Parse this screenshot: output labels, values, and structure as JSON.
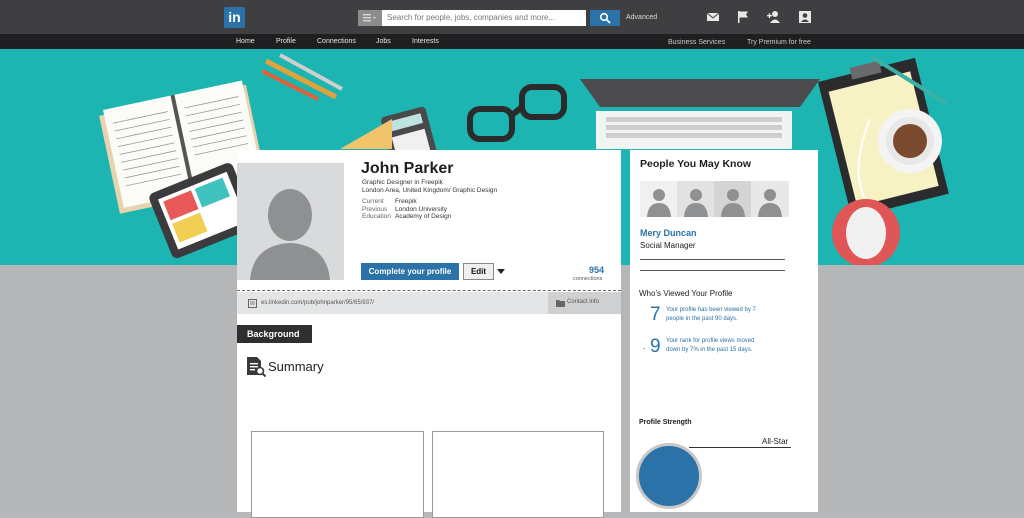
{
  "header": {
    "logo_text": "in",
    "search_placeholder": "Search for people, jobs, companies and more...",
    "advanced_label": "Advanced",
    "nav": [
      "Home",
      "Profile",
      "Connections",
      "Jobs",
      "Interests"
    ],
    "business_services": "Business Services",
    "premium": "Try Premium for free"
  },
  "profile": {
    "name": "John Parker",
    "headline": "Graphic Designer in Freepik",
    "location": "London Area, United Kingdom/ Graphic Design",
    "details": [
      {
        "label": "Current",
        "value": "Freepik"
      },
      {
        "label": "Previous",
        "value": "London University"
      },
      {
        "label": "Education",
        "value": "Academy of Design"
      }
    ],
    "complete_button": "Complete your profile",
    "edit_button": "Edit",
    "connections_count": "954",
    "connections_label": "connections",
    "url": "es.linkedin.com/pub/johnparker/95/65/937/",
    "contact_info": "Contact info"
  },
  "background": {
    "tab_label": "Background",
    "summary_heading": "Summary"
  },
  "sidebar": {
    "pymk_title": "People You May Know",
    "person_name": "Mery Duncan",
    "person_title": "Social Manager",
    "wvyp_title": "Who's Viewed Your Profile",
    "stats": [
      {
        "number": "7",
        "text_line1": "Your profile has been viewed by 7",
        "text_line2": "people in the past 90 days."
      },
      {
        "number": "9",
        "text_line1": "Your rank for profile views moved",
        "text_line2": "down by 7% in the past 15 days."
      }
    ],
    "strength_title": "Profile Strength",
    "strength_level": "All-Star"
  },
  "colors": {
    "brand_blue": "#2a72a8",
    "banner_teal": "#1cb5b2",
    "topbar": "#3f3f41"
  }
}
